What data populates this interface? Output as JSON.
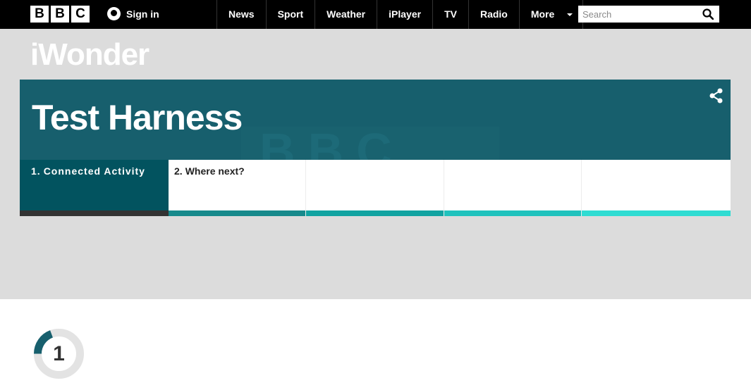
{
  "bbc_logo": [
    "B",
    "B",
    "C"
  ],
  "header": {
    "signin_label": "Sign in",
    "nav": [
      "News",
      "Sport",
      "Weather",
      "iPlayer",
      "TV",
      "Radio",
      "More"
    ],
    "search_placeholder": "Search"
  },
  "brand": "iWonder",
  "banner": {
    "title": "Test Harness",
    "watermark": "BBC"
  },
  "tabs": [
    {
      "num": "1.",
      "label": "Connected Activity",
      "bar_color": "#333333",
      "active": true
    },
    {
      "num": "2.",
      "label": "Where next?",
      "bar_color": "#178a8c"
    },
    {
      "num": "",
      "label": "",
      "bar_color": "#11a3a1"
    },
    {
      "num": "",
      "label": "",
      "bar_color": "#20c2bd"
    },
    {
      "num": "",
      "label": "",
      "bar_color": "#2fdcd2"
    }
  ],
  "step": {
    "number": "1"
  },
  "colors": {
    "banner": "#175f6d",
    "active_tab": "#02535f",
    "hero_bg": "#dcdcdc"
  }
}
